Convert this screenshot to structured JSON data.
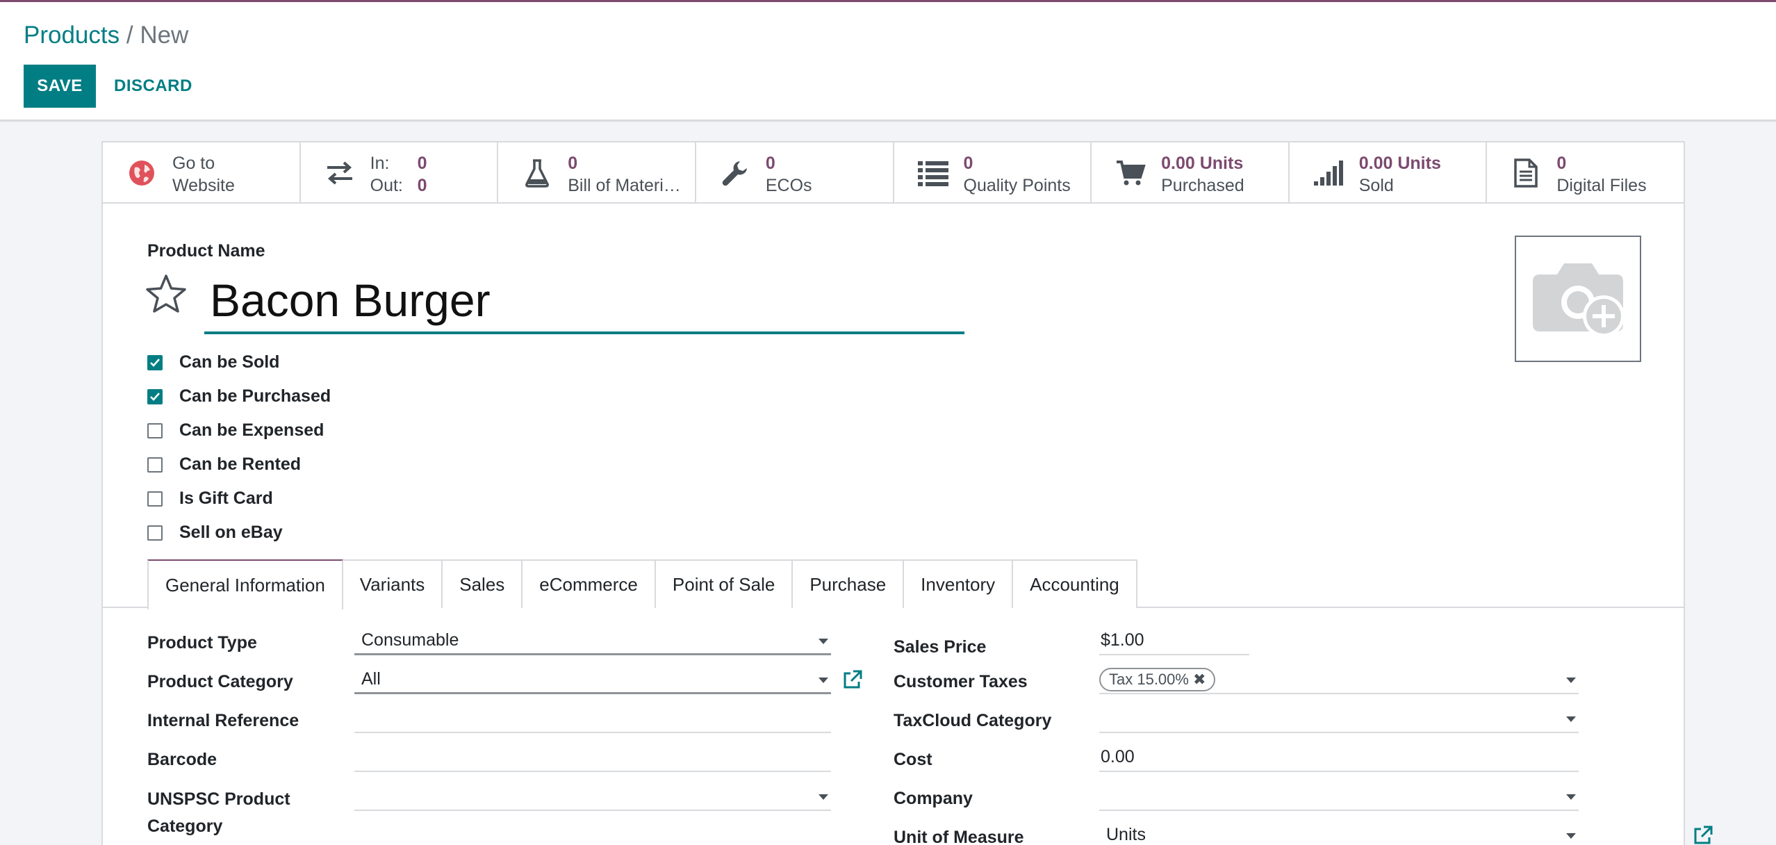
{
  "breadcrumb": {
    "parent": "Products",
    "separator": " / ",
    "current": "New"
  },
  "toolbar": {
    "save_label": "SAVE",
    "discard_label": "DISCARD"
  },
  "smart_buttons": [
    {
      "icon": "globe-icon",
      "line1": "Go to",
      "line2": "Website"
    },
    {
      "icon": "transfer-arrows-icon",
      "in_label": "In:",
      "in_value": "0",
      "out_label": "Out:",
      "out_value": "0"
    },
    {
      "icon": "flask-icon",
      "value": "0",
      "label": "Bill of Materi…"
    },
    {
      "icon": "wrench-icon",
      "value": "0",
      "label": "ECOs"
    },
    {
      "icon": "list-icon",
      "value": "0",
      "label": "Quality Points"
    },
    {
      "icon": "cart-icon",
      "value": "0.00 Units",
      "label": "Purchased"
    },
    {
      "icon": "signal-bars-icon",
      "value": "0.00 Units",
      "label": "Sold"
    },
    {
      "icon": "file-icon",
      "value": "0",
      "label": "Digital Files"
    }
  ],
  "product": {
    "name_label": "Product Name",
    "name": "Bacon Burger",
    "image_icon": "camera-add-icon"
  },
  "checkboxes": [
    {
      "label": "Can be Sold",
      "checked": true
    },
    {
      "label": "Can be Purchased",
      "checked": true
    },
    {
      "label": "Can be Expensed",
      "checked": false
    },
    {
      "label": "Can be Rented",
      "checked": false
    },
    {
      "label": "Is Gift Card",
      "checked": false
    },
    {
      "label": "Sell on eBay",
      "checked": false
    }
  ],
  "tabs": [
    "General Information",
    "Variants",
    "Sales",
    "eCommerce",
    "Point of Sale",
    "Purchase",
    "Inventory",
    "Accounting"
  ],
  "active_tab": "General Information",
  "form_left": {
    "product_type_label": "Product Type",
    "product_type_value": "Consumable",
    "product_category_label": "Product Category",
    "product_category_value": "All",
    "internal_reference_label": "Internal Reference",
    "internal_reference_value": "",
    "barcode_label": "Barcode",
    "barcode_value": "",
    "unspsc_label_1": "UNSPSC Product",
    "unspsc_label_2": "Category",
    "unspsc_value": ""
  },
  "form_right": {
    "sales_price_label": "Sales Price",
    "sales_price_value": "$1.00",
    "customer_taxes_label": "Customer Taxes",
    "customer_taxes_tag": "Tax 15.00%",
    "taxcloud_label": "TaxCloud Category",
    "taxcloud_value": "",
    "cost_label": "Cost",
    "cost_value": "0.00",
    "company_label": "Company",
    "company_value": "",
    "uom_label": "Unit of Measure",
    "uom_value": "Units"
  },
  "colors": {
    "primary": "#017e84",
    "accent": "#7c4a6f",
    "border": "#d8dadd"
  }
}
